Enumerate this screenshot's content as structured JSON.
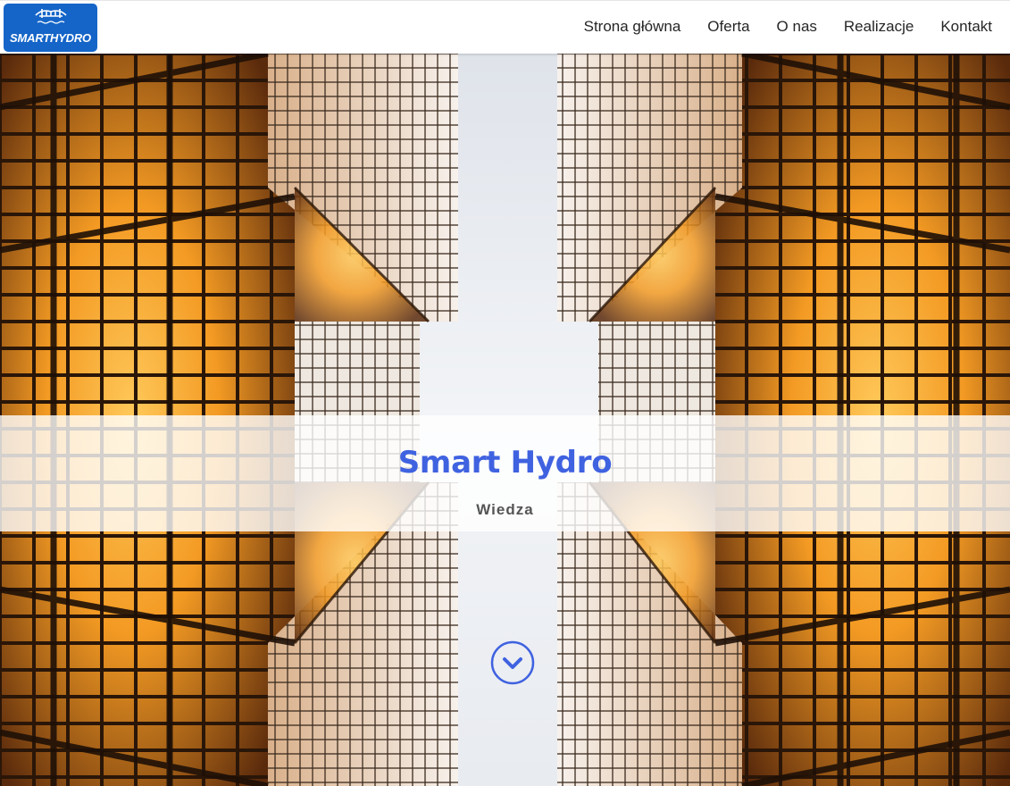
{
  "brand": {
    "logo_text": "SMARTHYDRO",
    "accent": "#1565c8",
    "title_color": "#3f62e0"
  },
  "nav": {
    "items": [
      "Strona główna",
      "Oferta",
      "O nas",
      "Realizacje",
      "Kontakt"
    ]
  },
  "hero": {
    "title": "Smart Hydro",
    "subtitle": "Wiedza",
    "scroll_icon": "chevron-down-circle-icon"
  }
}
